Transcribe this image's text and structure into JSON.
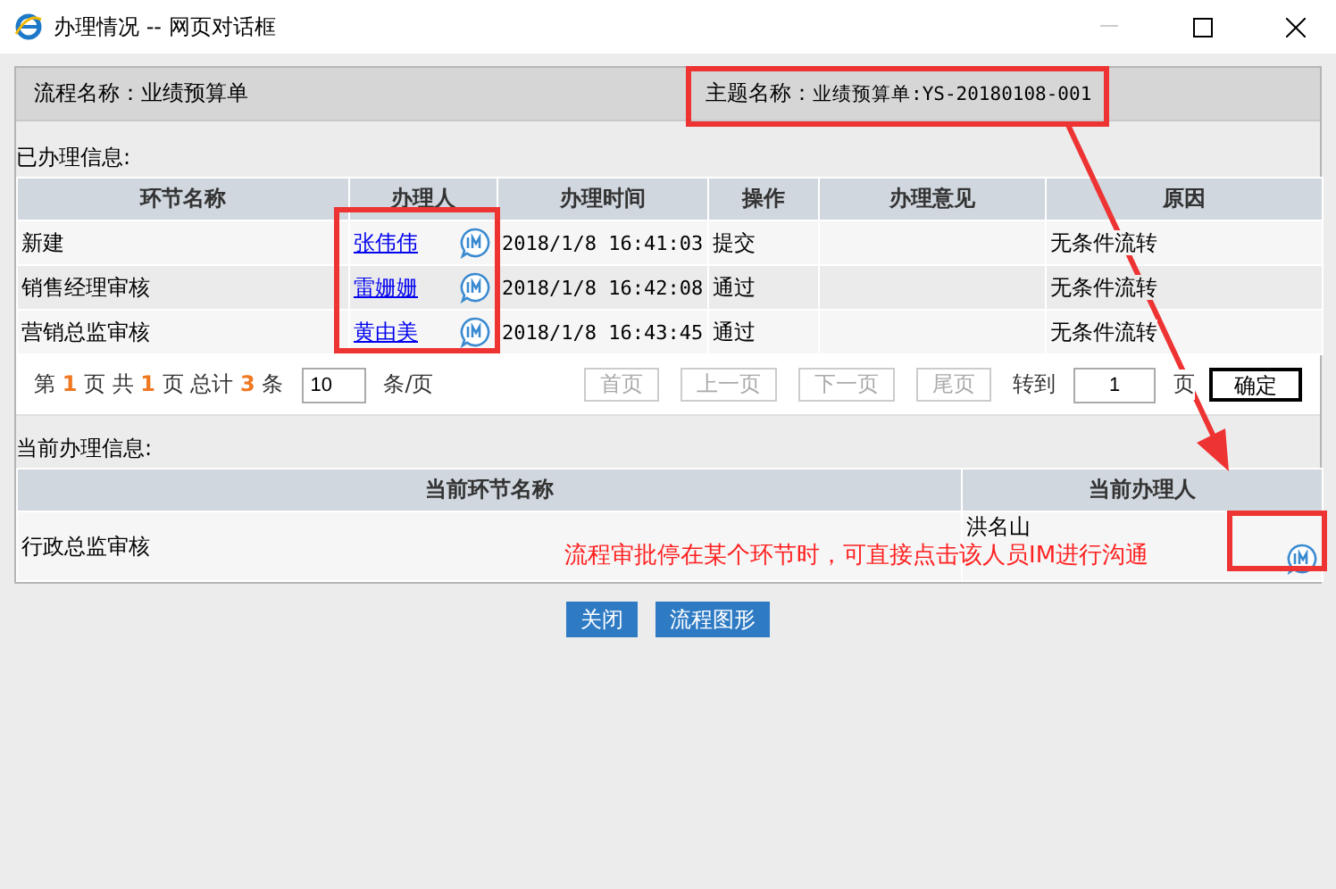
{
  "window": {
    "title": "办理情况 -- 网页对话框"
  },
  "header": {
    "flow_label": "流程名称：",
    "flow_name": "业绩预算单",
    "subject_label": "主题名称：",
    "subject": "业绩预算单:YS-20180108-001"
  },
  "done_section": {
    "title": "已办理信息:",
    "columns": [
      "环节名称",
      "办理人",
      "办理时间",
      "操作",
      "办理意见",
      "原因"
    ],
    "rows": [
      {
        "step": "新建",
        "handler": "张伟伟",
        "time": "2018/1/8 16:41:03",
        "action": "提交",
        "opinion": "",
        "reason": "无条件流转"
      },
      {
        "step": "销售经理审核",
        "handler": "雷姗姗",
        "time": "2018/1/8 16:42:08",
        "action": "通过",
        "opinion": "",
        "reason": "无条件流转"
      },
      {
        "step": "营销总监审核",
        "handler": "黄由美",
        "time": "2018/1/8 16:43:45",
        "action": "通过",
        "opinion": "",
        "reason": "无条件流转"
      }
    ]
  },
  "pagination": {
    "page_prefix": "第",
    "page": "1",
    "page_suffix": "页 共",
    "pages": "1",
    "pages_suffix": "页 总计",
    "total": "3",
    "total_suffix": "条",
    "page_size": "10",
    "page_size_suffix": "条/页",
    "buttons": [
      {
        "label": "首页",
        "disabled": true
      },
      {
        "label": "上一页",
        "disabled": true
      },
      {
        "label": "下一页",
        "disabled": true
      },
      {
        "label": "尾页",
        "disabled": true
      }
    ],
    "goto_label": "转到",
    "goto_value": "1",
    "goto_suffix": "页",
    "confirm": "确定"
  },
  "current_section": {
    "title": "当前办理信息:",
    "columns": [
      "当前环节名称",
      "当前办理人"
    ],
    "rows": [
      {
        "step": "行政总监审核",
        "handler": "洪名山"
      }
    ]
  },
  "buttons": [
    "关闭",
    "流程图形"
  ],
  "annotation": {
    "text": "流程审批停在某个环节时，可直接点击该人员IM进行沟通"
  }
}
